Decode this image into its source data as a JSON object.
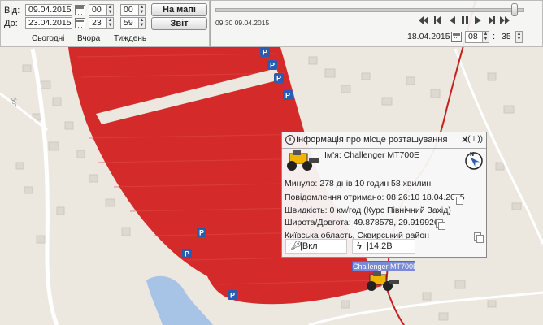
{
  "date_panel": {
    "from_label": "Від:",
    "to_label": "До:",
    "from_date": "09.04.2015",
    "from_hour": "00",
    "from_min": "00",
    "to_date": "23.04.2015",
    "to_hour": "23",
    "to_min": "59",
    "on_map_button": "На мапі",
    "report_button": "Звіт",
    "today_link": "Сьогодні",
    "yesterday_link": "Вчора",
    "week_link": "Тиждень"
  },
  "timeline": {
    "start_stamp": "09:30 09.04.2015",
    "cur_date": "18.04.2015",
    "cur_hour": "08",
    "cur_min": "35",
    "slider_position_fraction": 0.97
  },
  "popup": {
    "title": "Інформація про місце розташування",
    "name": "Ім'я: Challenger MT700E",
    "elapsed": "Минуло: 278 днів 10 годин 58 хвилин",
    "received": "Повідомлення отримано: 08:26:10 18.04.2015",
    "speed": "Швидкість: 0 км/год (Курс Північний Захід)",
    "coords": "Широта/Довгота: 49.878578, 29.919926",
    "location": "Київська область, Сквирський район",
    "ignition": "|Вкл",
    "voltage": "|14.2В",
    "compass": "N"
  },
  "vehicle_label": "Challenger MT700E",
  "map": {
    "road_label": "бот",
    "parking_glyph": "P",
    "field_color": "#d42a2a",
    "track_color": "#c81e1e"
  }
}
